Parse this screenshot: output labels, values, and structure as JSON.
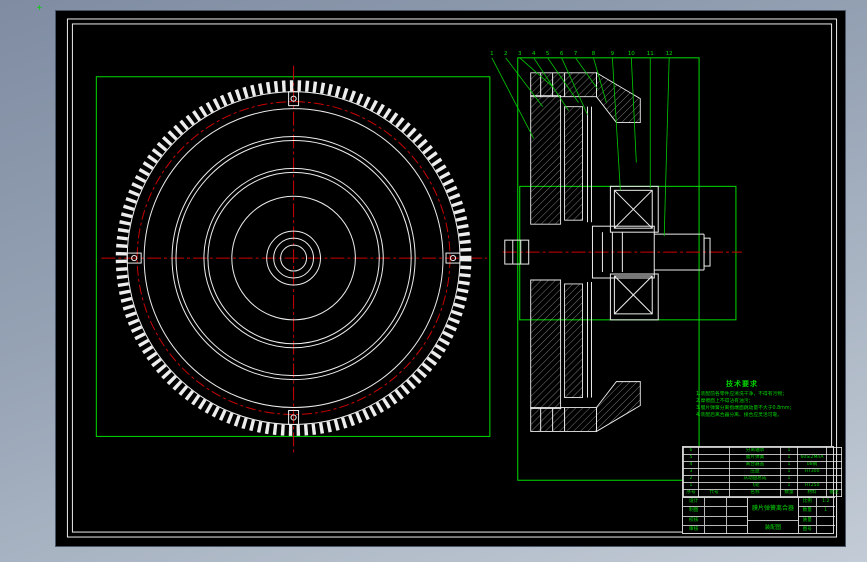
{
  "colors": {
    "canvas": "#000000",
    "line": "#ededed",
    "accent_green": "#00dd00",
    "centerline_red": "#cc0000",
    "background_top": "#7f8ca2",
    "background_bottom": "#c3ccd6"
  },
  "notes": {
    "title": "技术要求",
    "lines": [
      "1.装配前各零件应清洗干净，不得有污物；",
      "2.摩擦面上不得沾有油污；",
      "3.膜片弹簧分离指端面跳动量不大于0.8mm；",
      "4.装配后离合器分离、接合应灵活可靠。"
    ]
  },
  "callouts": [
    "1",
    "2",
    "3",
    "4",
    "5",
    "6",
    "7",
    "8",
    "9",
    "10",
    "11",
    "12"
  ],
  "parts": {
    "headers": [
      "序号",
      "代号",
      "名称",
      "数量",
      "材料",
      "备注"
    ],
    "rows": [
      [
        "6",
        "",
        "分离轴承",
        "1",
        "",
        ""
      ],
      [
        "5",
        "",
        "膜片弹簧",
        "1",
        "60Si2MnA",
        ""
      ],
      [
        "4",
        "",
        "离合器盖",
        "1",
        "08钢",
        ""
      ],
      [
        "3",
        "",
        "压盘",
        "1",
        "HT300",
        ""
      ],
      [
        "2",
        "",
        "从动盘总成",
        "1",
        "",
        ""
      ],
      [
        "1",
        "",
        "飞轮",
        "1",
        "HT250",
        ""
      ]
    ]
  },
  "tb": {
    "left_rows": [
      "设计",
      "制图",
      "校核",
      "审核"
    ],
    "name": "膜片弹簧离合器",
    "subtitle": "装配图",
    "right_rows": [
      [
        "比例",
        "1:2"
      ],
      [
        "数量",
        "1"
      ],
      [
        "质量",
        ""
      ],
      [
        "图号",
        ""
      ]
    ]
  }
}
